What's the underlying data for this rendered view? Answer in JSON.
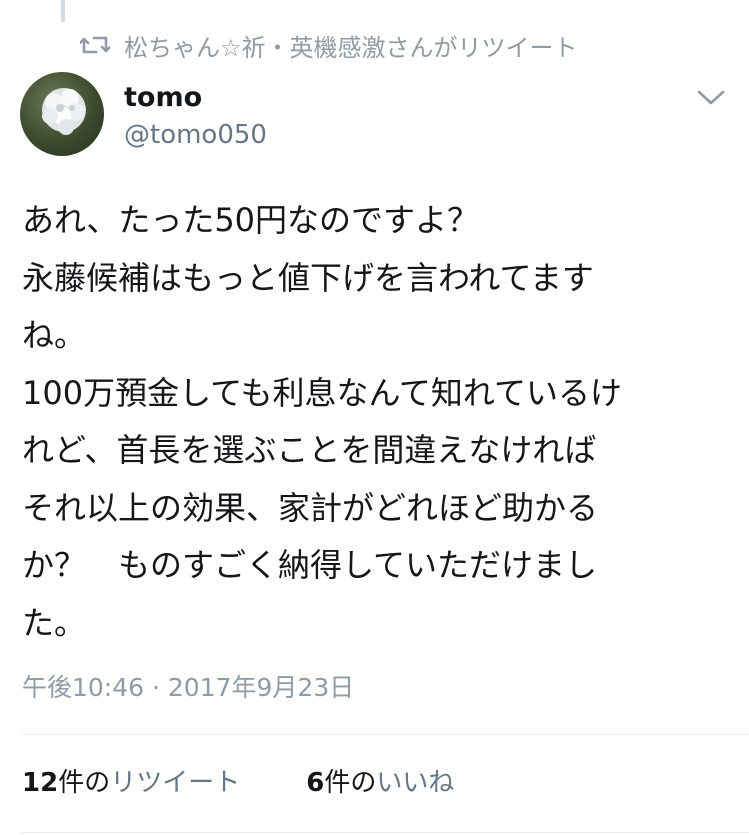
{
  "retweet_context": {
    "icon": "retweet-icon",
    "text": "松ちゃん☆祈・英機感激さんがリツイート"
  },
  "author": {
    "name": "tomo",
    "handle": "@tomo050",
    "avatar_icon": "hydrangea-flower-avatar"
  },
  "menu_icon": "chevron-down-icon",
  "tweet": {
    "lines": [
      "あれ、たった50円なのですよ？",
      "永藤候補はもっと値下げを言われてます",
      "ね。",
      "100万預金しても利息なんて知れているけ",
      "れど、首長を選ぶことを間違えなければ",
      "それ以上の効果、家計がどれほど助かる",
      "か？　ものすごく納得していただけまし",
      "た。"
    ]
  },
  "timestamp": "午後10:46 · 2017年9月23日",
  "stats": {
    "retweets": {
      "count": "12",
      "unit": "件の",
      "label": "リツイート"
    },
    "likes": {
      "count": "6",
      "unit": "件の",
      "label": "いいね"
    }
  },
  "colors": {
    "primary_text": "#14171a",
    "secondary_text": "#657786",
    "muted_text": "#8f9ba5",
    "divider": "#e6ecf0"
  }
}
